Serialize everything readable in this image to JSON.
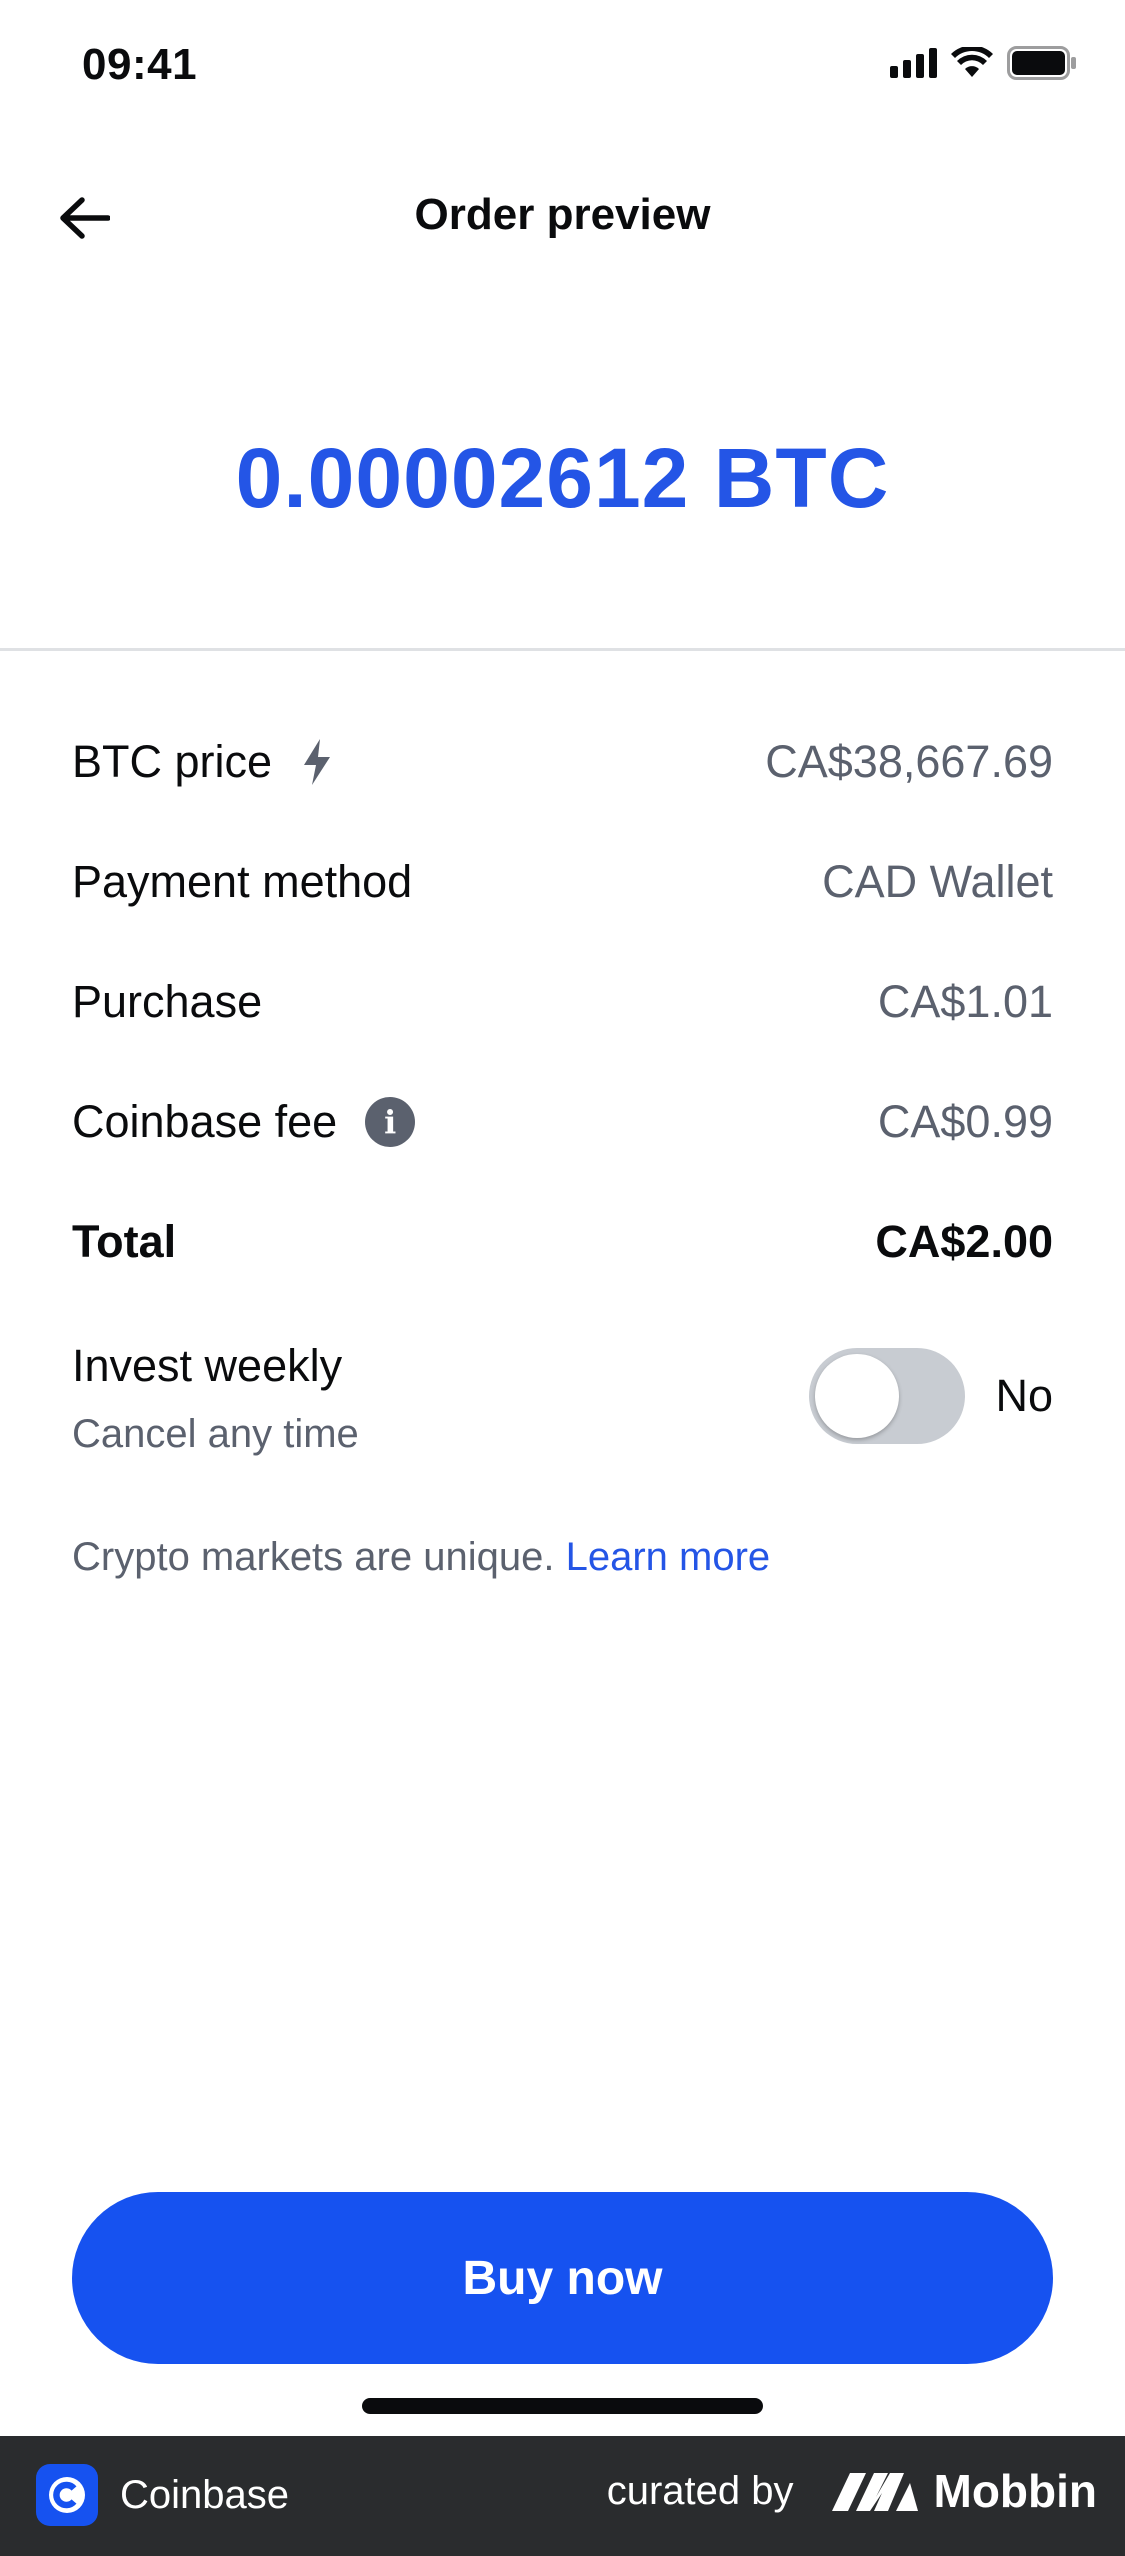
{
  "status_bar": {
    "time": "09:41"
  },
  "header": {
    "title": "Order preview"
  },
  "order": {
    "amount": "0.00002612 BTC"
  },
  "details": [
    {
      "label": "BTC price",
      "value": "CA$38,667.69"
    },
    {
      "label": "Payment method",
      "value": "CAD Wallet"
    },
    {
      "label": "Purchase",
      "value": "CA$1.01"
    },
    {
      "label": "Coinbase fee",
      "value": "CA$0.99"
    },
    {
      "label": "Total",
      "value": "CA$2.00"
    }
  ],
  "invest": {
    "title": "Invest weekly",
    "subtitle": "Cancel any time",
    "toggle_on": false,
    "toggle_state": "No"
  },
  "disclaimer": {
    "text": "Crypto markets are unique.",
    "link": "Learn more"
  },
  "buy_button": {
    "label": "Buy now"
  },
  "footer": {
    "app_name": "Coinbase",
    "curated_by": "curated by",
    "brand": "Mobbin"
  },
  "colors": {
    "accent": "#1652f0",
    "amount": "#2455e6",
    "text_secondary": "#5b616e",
    "footer_bg": "#2a2c2e"
  }
}
